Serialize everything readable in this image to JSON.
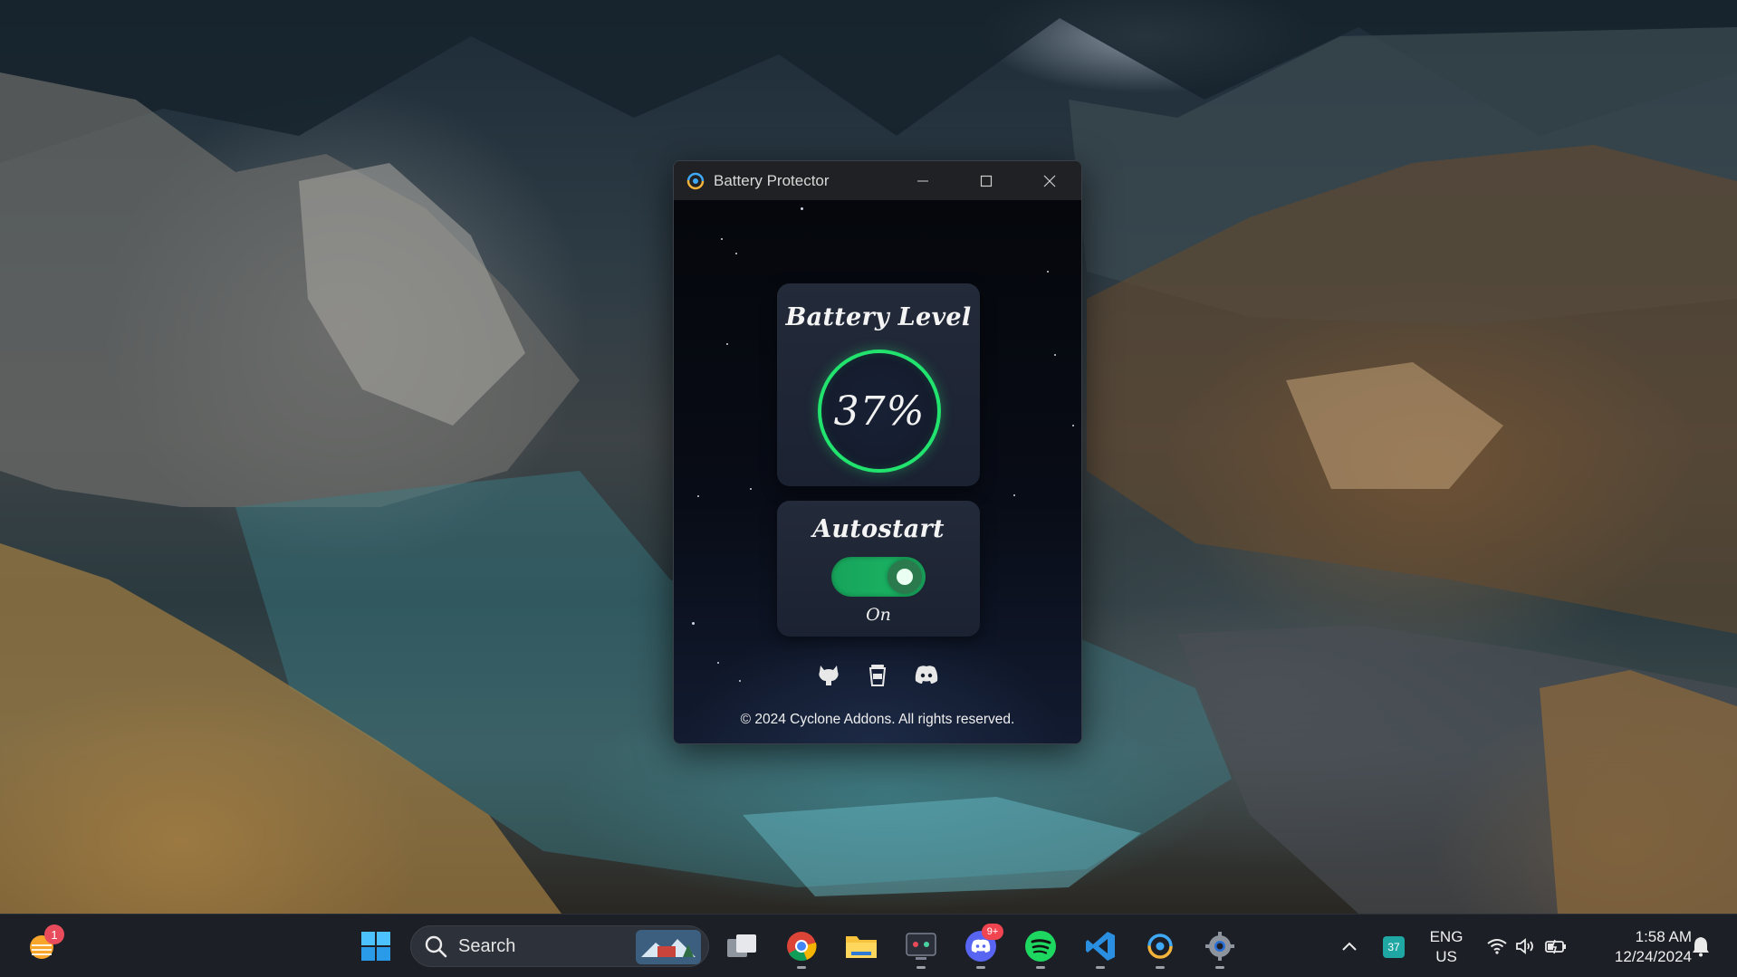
{
  "window": {
    "title": "Battery Protector"
  },
  "battery": {
    "heading": "Battery Level",
    "level_text": "37%",
    "level_percent": 37
  },
  "autostart": {
    "heading": "Autostart",
    "state_label": "On",
    "enabled": true
  },
  "social": {
    "icons": [
      "github-icon",
      "coffee-cup-icon",
      "discord-icon"
    ]
  },
  "footer": {
    "copyright": "© 2024 Cyclone Addons. All rights reserved."
  },
  "taskbar": {
    "weather_badge": "1",
    "search_label": "Search",
    "discord_badge": "9+",
    "tray_battery_badge": "37",
    "lang_line1": "ENG",
    "lang_line2": "US",
    "time": "1:58 AM",
    "date": "12/24/2024"
  },
  "colors": {
    "accent_green": "#21e36d",
    "toggle_green": "#17a35a",
    "card_bg": "#232a3a",
    "titlebar_bg": "#202124",
    "taskbar_bg": "#1c1f26"
  }
}
